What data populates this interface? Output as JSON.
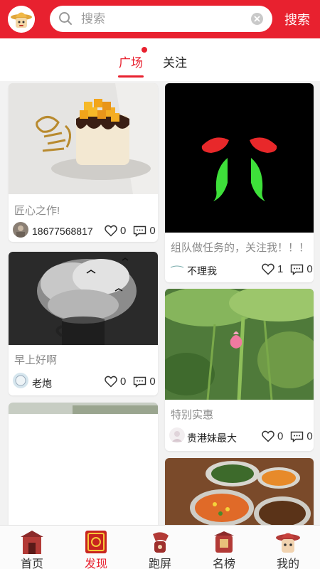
{
  "header": {
    "logo_icon": "straw-hat-mascot-icon",
    "search_placeholder": "搜索",
    "search_button": "搜索",
    "accent_color": "#e8212f"
  },
  "tabs": [
    {
      "label": "广场",
      "active": true,
      "has_dot": true
    },
    {
      "label": "关注",
      "active": false
    }
  ],
  "feed": {
    "left": [
      {
        "title": "匠心之作!",
        "author": "18677568817",
        "likes": "0",
        "comments": "0",
        "image": "mango-cake"
      },
      {
        "title": "早上好啊",
        "author": "老炮",
        "likes": "0",
        "comments": "0",
        "image": "smoking-coffee-cup"
      },
      {
        "title": "",
        "author": "",
        "likes": "",
        "comments": "",
        "image": "partial-photo"
      }
    ],
    "right": [
      {
        "title": "组队做任务的，关注我！！！",
        "author": "不理我",
        "likes": "1",
        "comments": "0",
        "image": "neon-face"
      },
      {
        "title": "特别实惠",
        "author": "贵港妹最大",
        "likes": "0",
        "comments": "0",
        "image": "lotus-leaves"
      },
      {
        "title": "",
        "author": "",
        "likes": "",
        "comments": "",
        "image": "food-dishes"
      }
    ]
  },
  "bottom_nav": [
    {
      "label": "首页",
      "icon": "home-gate-icon",
      "active": false
    },
    {
      "label": "发现",
      "icon": "discover-icon",
      "active": true
    },
    {
      "label": "跑屏",
      "icon": "run-screen-icon",
      "active": false
    },
    {
      "label": "名榜",
      "icon": "ranking-icon",
      "active": false
    },
    {
      "label": "我的",
      "icon": "mascot-profile-icon",
      "active": false
    }
  ]
}
